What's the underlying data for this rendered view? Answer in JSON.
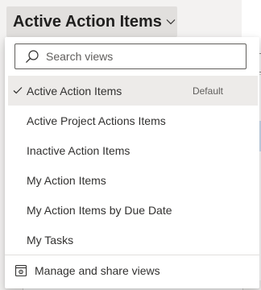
{
  "header": {
    "view_title": "Active Action Items"
  },
  "search": {
    "placeholder": "Search views",
    "value": ""
  },
  "views": [
    {
      "label": "Active Action Items",
      "badge": "Default",
      "selected": true
    },
    {
      "label": "Active Project Actions Items"
    },
    {
      "label": "Inactive Action Items"
    },
    {
      "label": "My Action Items"
    },
    {
      "label": "My Action Items by Due Date"
    },
    {
      "label": "My Tasks"
    }
  ],
  "footer": {
    "label": "Manage and share views"
  },
  "icons": {
    "chevron": "chevron-down-icon",
    "search": "search-icon",
    "check": "checkmark-icon",
    "manage": "manage-views-icon"
  },
  "colors": {
    "selected_row": "#edebe9",
    "header_bg": "#e1dfdd",
    "text": "#323130"
  }
}
